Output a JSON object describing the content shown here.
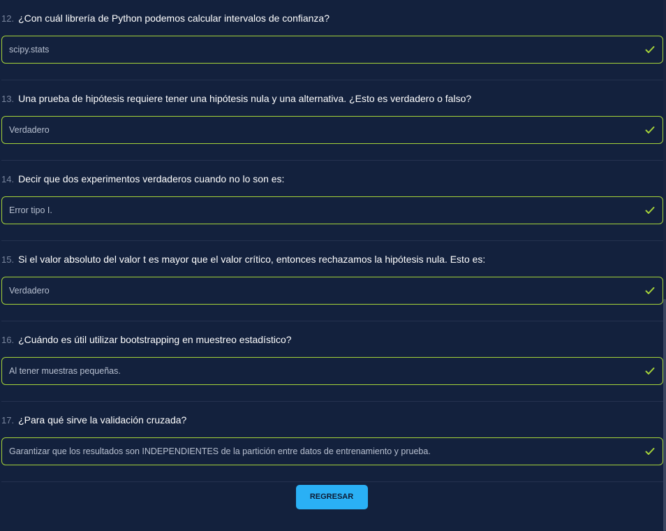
{
  "questions": [
    {
      "number": "12.",
      "text": "¿Con cuál librería de Python podemos calcular intervalos de confianza?",
      "answer": "scipy.stats"
    },
    {
      "number": "13.",
      "text": "Una prueba de hipótesis requiere tener una hipótesis nula y una alternativa. ¿Esto es verdadero o falso?",
      "answer": "Verdadero"
    },
    {
      "number": "14.",
      "text": "Decir que dos experimentos verdaderos cuando no lo son es:",
      "answer": "Error tipo I."
    },
    {
      "number": "15.",
      "text": "Si el valor absoluto del valor t es mayor que el valor crítico, entonces rechazamos la hipótesis nula. Esto es:",
      "answer": "Verdadero"
    },
    {
      "number": "16.",
      "text": "¿Cuándo es útil utilizar bootstrapping en muestreo estadístico?",
      "answer": "Al tener muestras pequeñas."
    },
    {
      "number": "17.",
      "text": "¿Para qué sirve la validación cruzada?",
      "answer": "Garantizar que los resultados son INDEPENDIENTES de la partición entre datos de entrenamiento y prueba."
    }
  ],
  "back_button": {
    "label": "REGRESAR"
  },
  "colors": {
    "background": "#13213d",
    "correct_border": "#a6d43a",
    "check": "#a6d43a",
    "button": "#2ab0f5"
  },
  "icons": {
    "answer_status": "check-icon"
  }
}
